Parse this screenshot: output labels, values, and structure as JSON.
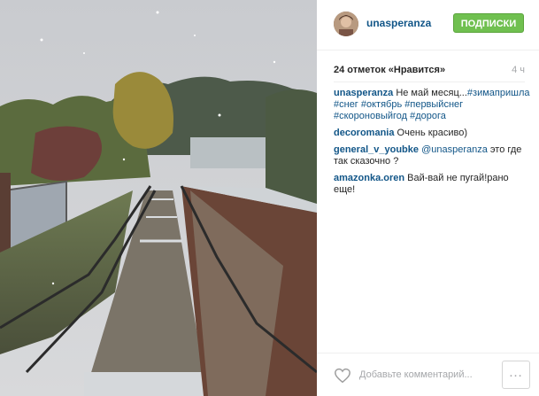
{
  "post": {
    "username": "unasperanza",
    "follow_label": "ПОДПИСКИ",
    "likes": "24 отметок «Нравится»",
    "time_ago": "4 ч",
    "caption": {
      "author": "unasperanza",
      "text": "Не май месяц...",
      "tags_1": "#зимапришла",
      "tags_2": "#снег #октябрь #первыйснег",
      "tags_3": "#скороновыйгод #дорога"
    },
    "comments": [
      {
        "author": "decoromania",
        "text": "Очень красиво)"
      },
      {
        "author": "general_v_youbke",
        "mention": "@unasperanza",
        "text": "это где так сказочно ?"
      },
      {
        "author": "amazonka.oren",
        "text": "Вай-вай не пугай!рано еще!"
      }
    ],
    "comment_placeholder": "Добавьте комментарий...",
    "more_symbol": "…"
  },
  "colors": {
    "link": "#125688",
    "follow": "#70c050",
    "muted": "#a5a7aa"
  },
  "icons": [
    "heart-icon",
    "more-options-icon"
  ]
}
